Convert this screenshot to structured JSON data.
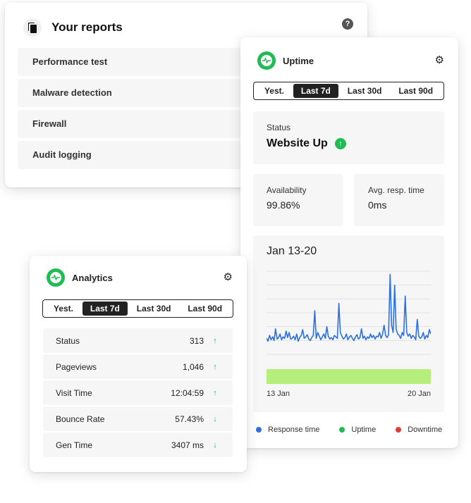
{
  "reports": {
    "title": "Your reports",
    "items": [
      "Performance test",
      "Malware detection",
      "Firewall",
      "Audit logging"
    ]
  },
  "uptime": {
    "title": "Uptime",
    "tabs": [
      "Yest.",
      "Last 7d",
      "Last 30d",
      "Last 90d"
    ],
    "active_tab": "Last 7d",
    "status_label": "Status",
    "status_value": "Website Up",
    "availability_label": "Availability",
    "availability_value": "99.86%",
    "resp_label": "Avg. resp. time",
    "resp_value": "0ms",
    "legend": {
      "response": "Response time",
      "uptime": "Uptime",
      "downtime": "Downtime"
    },
    "colors": {
      "response": "#2b6fe0",
      "uptime": "#1fbc53",
      "downtime": "#e53935",
      "uptime_bar": "#b6ee7b"
    }
  },
  "chart_data": {
    "type": "line",
    "title": "Jan 13-20",
    "x_ticks": [
      "13 Jan",
      "20 Jan"
    ],
    "series": [
      {
        "values": [
          22,
          18,
          26,
          20,
          24,
          19,
          35,
          21,
          23,
          28,
          20,
          24,
          22,
          32,
          23,
          30,
          21,
          22,
          25,
          20,
          28,
          18,
          23,
          26,
          34,
          22,
          24,
          27,
          21,
          19,
          23,
          26,
          60,
          22,
          30,
          25,
          20,
          24,
          28,
          22,
          38,
          25,
          21,
          23,
          20,
          26,
          24,
          22,
          70,
          30,
          25,
          21,
          23,
          28,
          20,
          24,
          26,
          22,
          19,
          24,
          27,
          21,
          23,
          35,
          22,
          25,
          20,
          24,
          22,
          28,
          23,
          26,
          21,
          25,
          24,
          30,
          22,
          28,
          40,
          26,
          23,
          27,
          110,
          40,
          30,
          95,
          35,
          28,
          26,
          22,
          30,
          26,
          80,
          30,
          25,
          28,
          22,
          26,
          24,
          20,
          48,
          25,
          22,
          24,
          30,
          21,
          26,
          23,
          34,
          28
        ]
      }
    ],
    "ylim": [
      0,
      120
    ],
    "grid": true,
    "uptime_bar": 100
  },
  "analytics": {
    "title": "Analytics",
    "tabs": [
      "Yest.",
      "Last 7d",
      "Last 30d",
      "Last 90d"
    ],
    "active_tab": "Last 7d",
    "rows": [
      {
        "name": "Status",
        "value": "313",
        "trend": "up"
      },
      {
        "name": "Pageviews",
        "value": "1,046",
        "trend": "up"
      },
      {
        "name": "Visit Time",
        "value": "12:04:59",
        "trend": "up"
      },
      {
        "name": "Bounce Rate",
        "value": "57.43%",
        "trend": "down"
      },
      {
        "name": "Gen Time",
        "value": "3407 ms",
        "trend": "down"
      }
    ]
  }
}
